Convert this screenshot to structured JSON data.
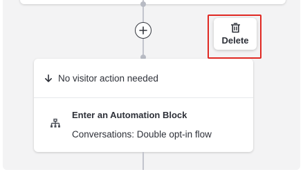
{
  "canvas": {
    "add_step_icon": "plus-icon",
    "delete_action": {
      "label": "Delete",
      "icon": "trash-icon",
      "highlight_color": "#e02721"
    }
  },
  "step_card": {
    "trigger": {
      "icon": "arrow-down-icon",
      "text": "No visitor action needed"
    },
    "block": {
      "icon": "hierarchy-icon",
      "title": "Enter an Automation Block",
      "subtitle": "Conversations: Double opt-in flow"
    }
  }
}
